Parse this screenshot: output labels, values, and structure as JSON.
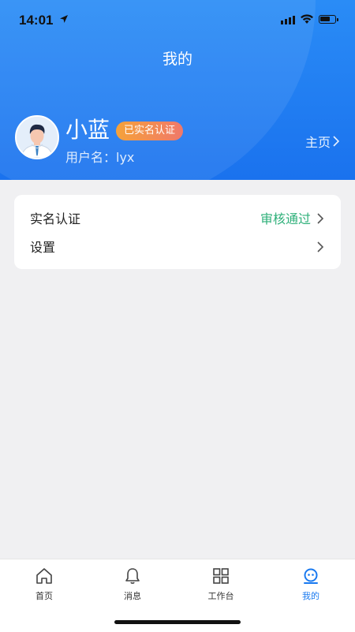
{
  "status_bar": {
    "time": "14:01"
  },
  "header": {
    "title": "我的",
    "user_name": "小蓝",
    "verified_badge": "已实名认证",
    "username_line": "用户名：lyx",
    "home_link": "主页"
  },
  "menu": [
    {
      "label": "实名认证",
      "value": "审核通过"
    },
    {
      "label": "设置",
      "value": ""
    }
  ],
  "tabs": [
    {
      "label": "首页",
      "icon": "home-icon"
    },
    {
      "label": "消息",
      "icon": "bell-icon"
    },
    {
      "label": "工作台",
      "icon": "grid-icon"
    },
    {
      "label": "我的",
      "icon": "profile-icon",
      "active": true
    }
  ],
  "colors": {
    "primary": "#1a7af0",
    "success": "#2fb07a",
    "badge_from": "#f5a23a",
    "badge_to": "#f0786a"
  }
}
